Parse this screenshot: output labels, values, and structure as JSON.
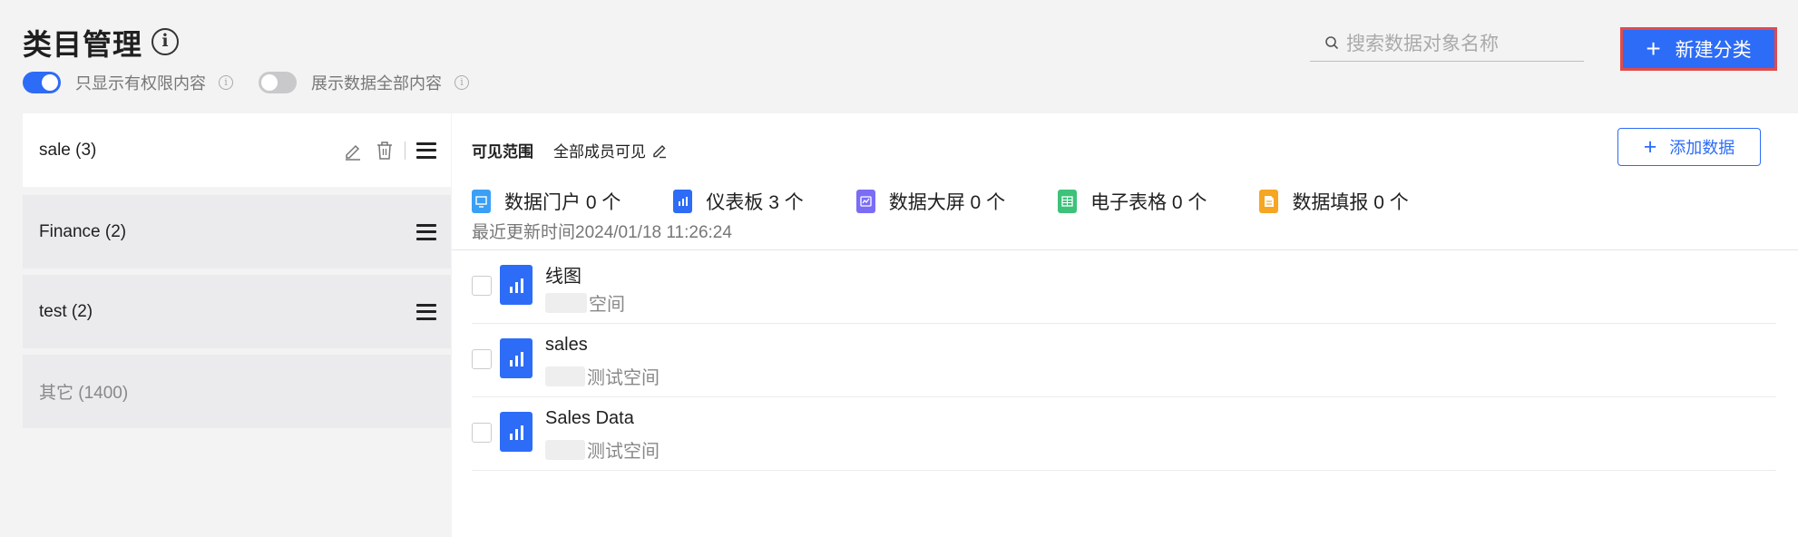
{
  "header": {
    "title": "类目管理",
    "toggle_permission_label": "只显示有权限内容",
    "toggle_permission_on": true,
    "toggle_all_label": "展示数据全部内容",
    "toggle_all_on": false,
    "search_placeholder": "搜索数据对象名称",
    "new_category_label": "新建分类"
  },
  "categories": [
    {
      "label": "sale (3)",
      "active": true
    },
    {
      "label": "Finance (2)",
      "active": false
    },
    {
      "label": "test (2)",
      "active": false
    },
    {
      "label": "其它 (1400)",
      "active": false
    }
  ],
  "panel": {
    "visibility_label": "可见范围",
    "visibility_value": "全部成员可见",
    "add_data_label": "添加数据",
    "stats": [
      {
        "label": "数据门户 0 个",
        "icon": "portal-icon",
        "color": "#3aa0f5"
      },
      {
        "label": "仪表板 3 个",
        "icon": "dashboard-icon",
        "color": "#2d6cf6"
      },
      {
        "label": "数据大屏 0 个",
        "icon": "big-screen-icon",
        "color": "#7b6cf6"
      },
      {
        "label": "电子表格 0 个",
        "icon": "spreadsheet-icon",
        "color": "#3ec27a"
      },
      {
        "label": "数据填报 0 个",
        "icon": "form-icon",
        "color": "#f5a623"
      }
    ],
    "updated": "最近更新时间2024/01/18 11:26:24",
    "items": [
      {
        "name": "线图",
        "workspace": "空间"
      },
      {
        "name": "sales",
        "workspace": "测试空间"
      },
      {
        "name": "Sales Data",
        "workspace": "测试空间"
      }
    ]
  },
  "colors": {
    "accent": "#2d6cf6",
    "highlight": "#e04b4b"
  }
}
